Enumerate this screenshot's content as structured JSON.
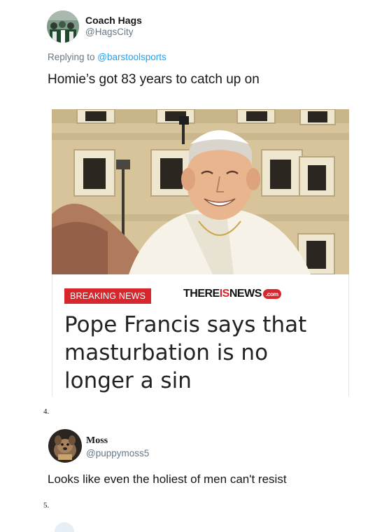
{
  "tweet1": {
    "display_name": "Coach Hags",
    "handle": "@HagsCity",
    "replying_prefix": "Replying to ",
    "replying_to": "@barstoolsports",
    "text": "Homie’s got 83 years to catch up on"
  },
  "news_card": {
    "badge": "BREAKING NEWS",
    "brand_part1": "THERE",
    "brand_part2": "IS",
    "brand_part3": "NEWS",
    "brand_suffix": ".com",
    "headline": "Pope Francis says that masturbation is no longer a sin"
  },
  "item_number_1": "4.",
  "tweet2": {
    "display_name": "Moss",
    "handle": "@puppymoss5",
    "text": "Looks like even the holiest of men can't resist"
  },
  "item_number_2": "5.",
  "colors": {
    "link": "#1da1f2",
    "muted": "#657786",
    "badge_red": "#d7262c"
  }
}
